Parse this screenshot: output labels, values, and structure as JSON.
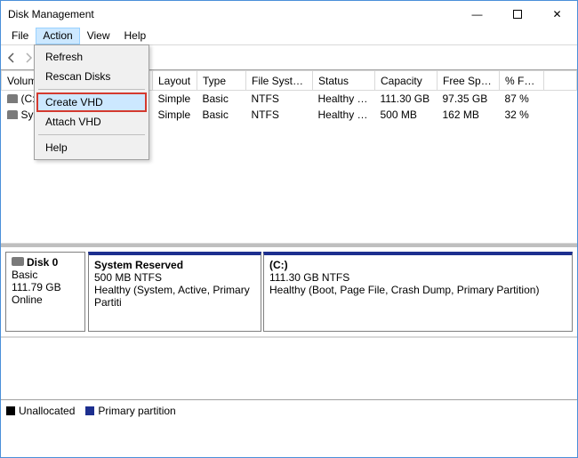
{
  "window": {
    "title": "Disk Management"
  },
  "menubar": {
    "items": [
      "File",
      "Action",
      "View",
      "Help"
    ],
    "active_index": 1
  },
  "dropdown": {
    "items": [
      "Refresh",
      "Rescan Disks",
      "Create VHD",
      "Attach VHD",
      "Help"
    ],
    "highlight_index": 2
  },
  "table": {
    "headers": [
      "Volume",
      "Layout",
      "Type",
      "File System",
      "Status",
      "Capacity",
      "Free Spa...",
      "% Free"
    ],
    "rows": [
      {
        "volume": "(C:)",
        "layout": "Simple",
        "type": "Basic",
        "fs": "NTFS",
        "status": "Healthy (B...",
        "capacity": "111.30 GB",
        "free": "97.35 GB",
        "pct": "87 %"
      },
      {
        "volume": "System Reserved",
        "layout": "Simple",
        "type": "Basic",
        "fs": "NTFS",
        "status": "Healthy (S...",
        "capacity": "500 MB",
        "free": "162 MB",
        "pct": "32 %"
      }
    ]
  },
  "disk": {
    "name": "Disk 0",
    "type": "Basic",
    "size": "111.79 GB",
    "status": "Online",
    "partitions": [
      {
        "title": "System Reserved",
        "line2": "500 MB NTFS",
        "line3": "Healthy (System, Active, Primary Partiti"
      },
      {
        "title": "(C:)",
        "line2": "111.30 GB NTFS",
        "line3": "Healthy (Boot, Page File, Crash Dump, Primary Partition)"
      }
    ]
  },
  "legend": {
    "unallocated": "Unallocated",
    "primary": "Primary partition"
  }
}
